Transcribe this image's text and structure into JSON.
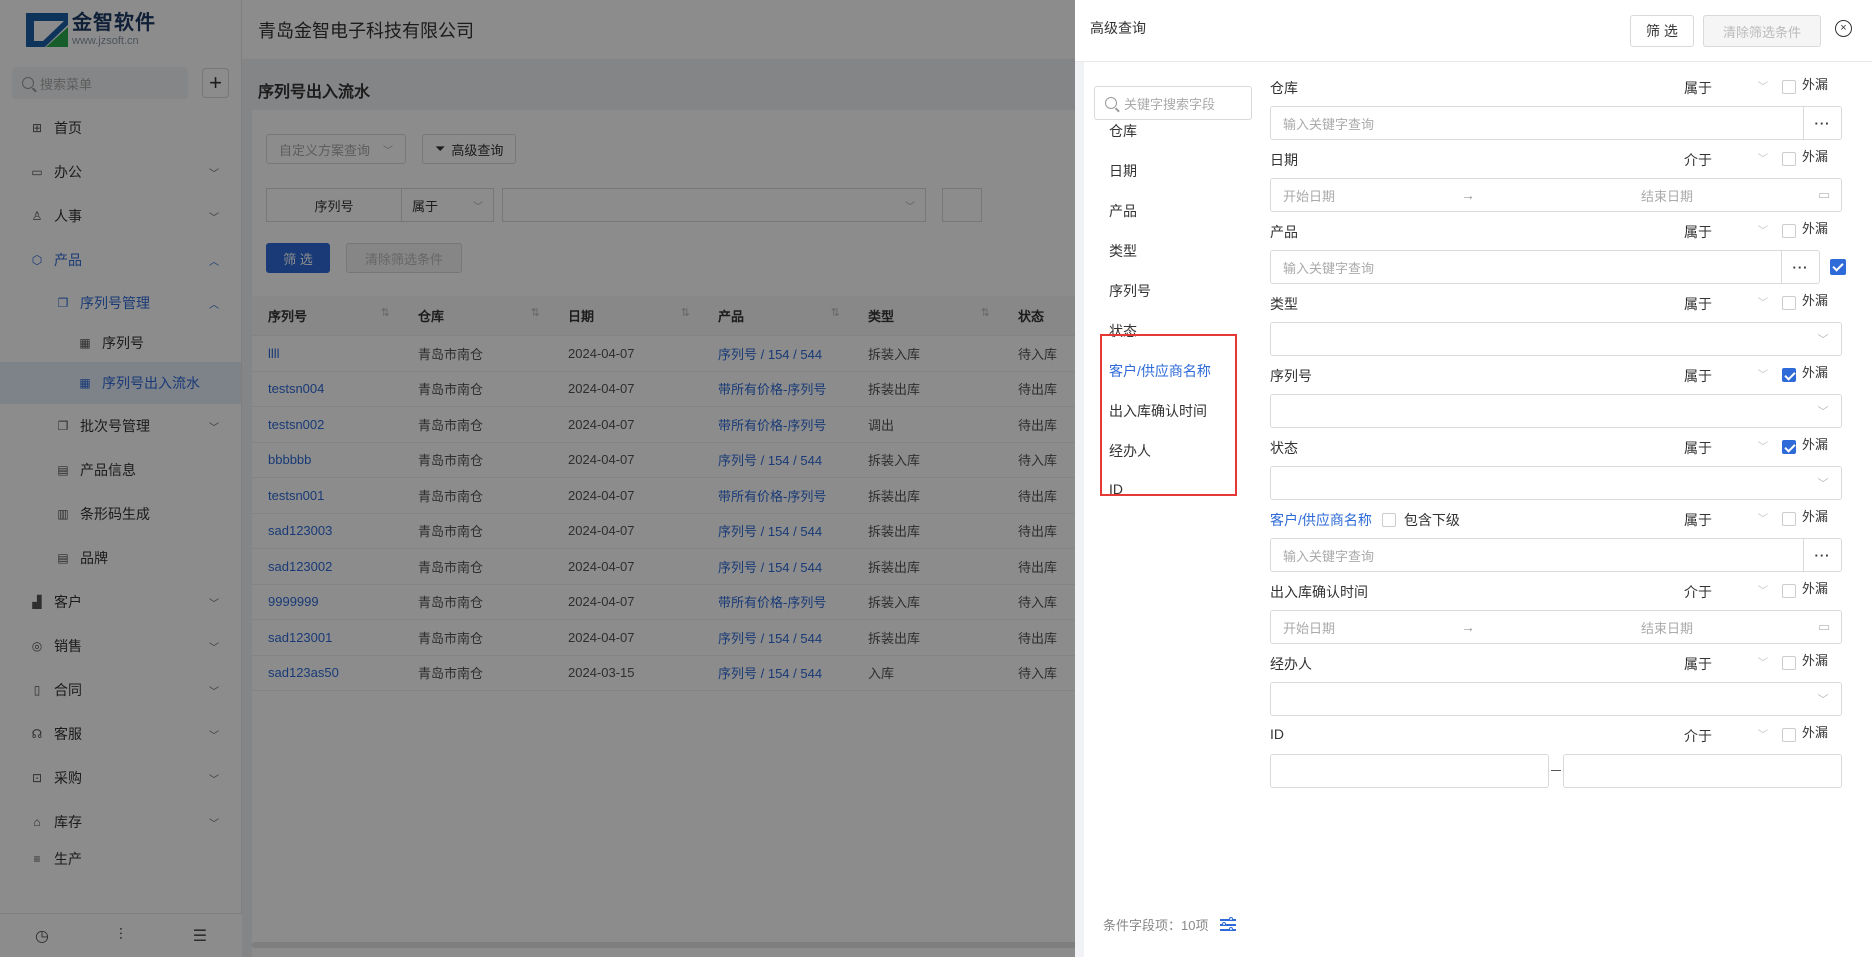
{
  "app": {
    "logo_cn": "金智软件",
    "logo_en": "www.jzsoft.cn",
    "company": "青岛金智电子科技有限公司"
  },
  "sidebar": {
    "search_placeholder": "搜索菜单",
    "add_label": "+",
    "items": [
      {
        "label": "首页",
        "icon": "⊞"
      },
      {
        "label": "办公",
        "icon": "▭"
      },
      {
        "label": "人事",
        "icon": "♙"
      },
      {
        "label": "产品",
        "icon": "⬡"
      },
      {
        "label": "序列号管理",
        "icon": "❐"
      },
      {
        "label": "序列号",
        "icon": "▦"
      },
      {
        "label": "序列号出入流水",
        "icon": "▦"
      },
      {
        "label": "批次号管理",
        "icon": "❐"
      },
      {
        "label": "产品信息",
        "icon": "▤"
      },
      {
        "label": "条形码生成",
        "icon": "▥"
      },
      {
        "label": "品牌",
        "icon": "▤"
      },
      {
        "label": "客户",
        "icon": "▟"
      },
      {
        "label": "销售",
        "icon": "◎"
      },
      {
        "label": "合同",
        "icon": "▯"
      },
      {
        "label": "客服",
        "icon": "☊"
      },
      {
        "label": "采购",
        "icon": "⊡"
      },
      {
        "label": "库存",
        "icon": "⌂"
      },
      {
        "label": "生产",
        "icon": "≡"
      }
    ]
  },
  "page": {
    "title": "序列号出入流水",
    "scheme_placeholder": "自定义方案查询",
    "advanced_btn": "高级查询",
    "filter_field": "序列号",
    "filter_op": "属于",
    "filter_btn": "筛 选",
    "clear_btn": "清除筛选条件"
  },
  "grid": {
    "columns": [
      "序列号",
      "仓库",
      "日期",
      "产品",
      "类型",
      "状态"
    ],
    "rows": [
      [
        "llll",
        "青岛市南仓",
        "2024-04-07",
        "序列号 / 154 / 544",
        "拆装入库",
        "待入库"
      ],
      [
        "testsn004",
        "青岛市南仓",
        "2024-04-07",
        "带所有价格-序列号",
        "拆装出库",
        "待出库"
      ],
      [
        "testsn002",
        "青岛市南仓",
        "2024-04-07",
        "带所有价格-序列号",
        "调出",
        "待出库"
      ],
      [
        "bbbbbb",
        "青岛市南仓",
        "2024-04-07",
        "序列号 / 154 / 544",
        "拆装入库",
        "待入库"
      ],
      [
        "testsn001",
        "青岛市南仓",
        "2024-04-07",
        "带所有价格-序列号",
        "拆装出库",
        "待出库"
      ],
      [
        "sad123003",
        "青岛市南仓",
        "2024-04-07",
        "序列号 / 154 / 544",
        "拆装出库",
        "待出库"
      ],
      [
        "sad123002",
        "青岛市南仓",
        "2024-04-07",
        "序列号 / 154 / 544",
        "拆装出库",
        "待出库"
      ],
      [
        "9999999",
        "青岛市南仓",
        "2024-04-07",
        "带所有价格-序列号",
        "拆装入库",
        "待入库"
      ],
      [
        "sad123001",
        "青岛市南仓",
        "2024-04-07",
        "序列号 / 154 / 544",
        "拆装出库",
        "待出库"
      ],
      [
        "sad123as50",
        "青岛市南仓",
        "2024-03-15",
        "序列号 / 154 / 544",
        "入库",
        "待入库"
      ]
    ]
  },
  "drawer": {
    "title": "高级查询",
    "filter_btn": "筛 选",
    "clear_btn": "清除筛选条件",
    "close_icon": "×",
    "search_placeholder": "关键字搜索字段",
    "fields": [
      "仓库",
      "日期",
      "产品",
      "类型",
      "序列号",
      "状态",
      "客户/供应商名称",
      "出入库确认时间",
      "经办人",
      "ID"
    ],
    "footer": "条件字段项：10项",
    "external_label": "外漏",
    "include_sub": "包含下级",
    "keyword_placeholder": "输入关键字查询",
    "date_start": "开始日期",
    "date_end": "结束日期",
    "more": "···",
    "conditions": [
      {
        "label": "仓库",
        "op": "属于",
        "ext": false
      },
      {
        "label": "日期",
        "op": "介于",
        "ext": false
      },
      {
        "label": "产品",
        "op": "属于",
        "ext": false
      },
      {
        "label": "类型",
        "op": "属于",
        "ext": false
      },
      {
        "label": "序列号",
        "op": "属于",
        "ext": true
      },
      {
        "label": "状态",
        "op": "属于",
        "ext": true
      },
      {
        "label": "客户/供应商名称",
        "op": "属于",
        "ext": false
      },
      {
        "label": "出入库确认时间",
        "op": "介于",
        "ext": false
      },
      {
        "label": "经办人",
        "op": "属于",
        "ext": false
      },
      {
        "label": "ID",
        "op": "介于",
        "ext": false
      }
    ]
  }
}
